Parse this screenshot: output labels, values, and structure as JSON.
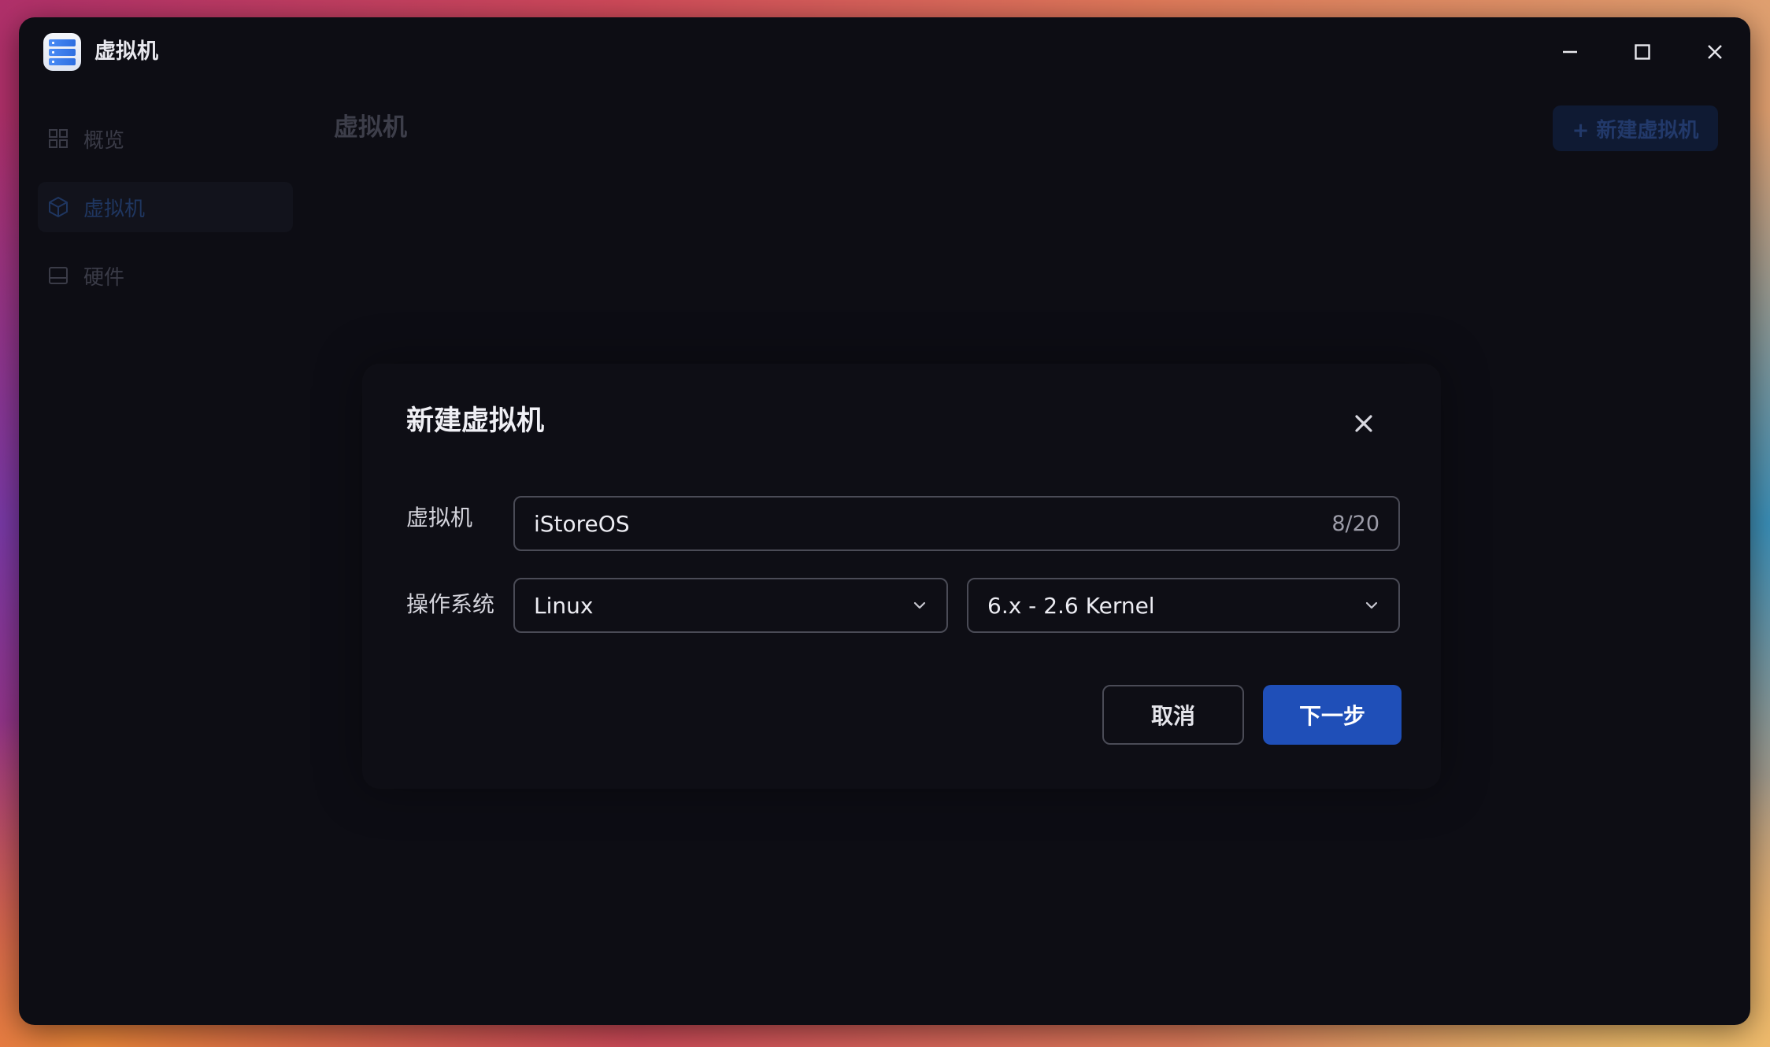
{
  "window": {
    "title": "虚拟机",
    "app_icon": "server-stack-icon",
    "controls": {
      "minimize_icon": "minimize-icon",
      "maximize_icon": "maximize-icon",
      "close_icon": "close-icon"
    }
  },
  "sidebar": {
    "items": [
      {
        "label": "概览",
        "icon": "grid-icon",
        "active": false
      },
      {
        "label": "虚拟机",
        "icon": "cube-icon",
        "active": true
      },
      {
        "label": "硬件",
        "icon": "drive-icon",
        "active": false
      }
    ]
  },
  "main": {
    "title": "虚拟机",
    "new_vm_button": "+ 新建虚拟机"
  },
  "dialog": {
    "title": "新建虚拟机",
    "close_icon": "close-icon",
    "vm_label": "虚拟机",
    "vm_name_value": "iStoreOS",
    "vm_name_count": "8/20",
    "os_label": "操作系统",
    "os_type_value": "Linux",
    "os_version_value": "6.x - 2.6 Kernel",
    "cancel_label": "取消",
    "next_label": "下一步"
  },
  "colors": {
    "window_bg": "#0d0d14",
    "accent": "#1f4fb8"
  }
}
